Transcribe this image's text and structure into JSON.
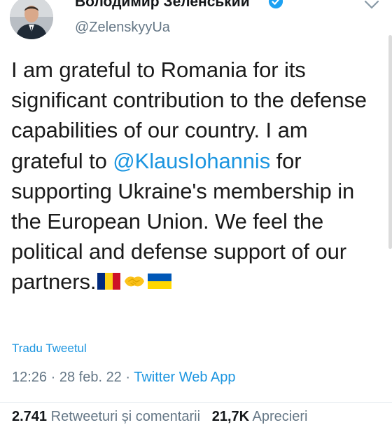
{
  "author": {
    "display_name": "Володимир Зеленський",
    "handle": "@ZelenskyyUa",
    "verified": true
  },
  "tweet": {
    "text_before_mention": "I am grateful to Romania for its significant contribution to the defense capabilities of our country. I am grateful to ",
    "mention": "@KlausIohannis",
    "text_after_mention": " for supporting Ukraine's membership in the European Union. We feel the political and defense support of our partners.",
    "emojis": [
      "romania-flag-emoji",
      "handshake-emoji",
      "ukraine-flag-emoji"
    ],
    "translate_label": "Tradu Tweetul",
    "time": "12:26",
    "date": "28 feb. 22",
    "source": "Twitter Web App",
    "separator": " · "
  },
  "stats": {
    "retweets_count": "2.741",
    "retweets_label": "Retweeturi și comentarii",
    "likes_count": "21,7K",
    "likes_label": "Aprecieri"
  },
  "colors": {
    "link": "#1b95e0",
    "muted": "#657786",
    "text": "#1a1a1a",
    "romania_blue": "#002b7f",
    "romania_yellow": "#fcd116",
    "romania_red": "#ce1126",
    "ukraine_blue": "#0057b7",
    "ukraine_yellow": "#ffd700"
  }
}
